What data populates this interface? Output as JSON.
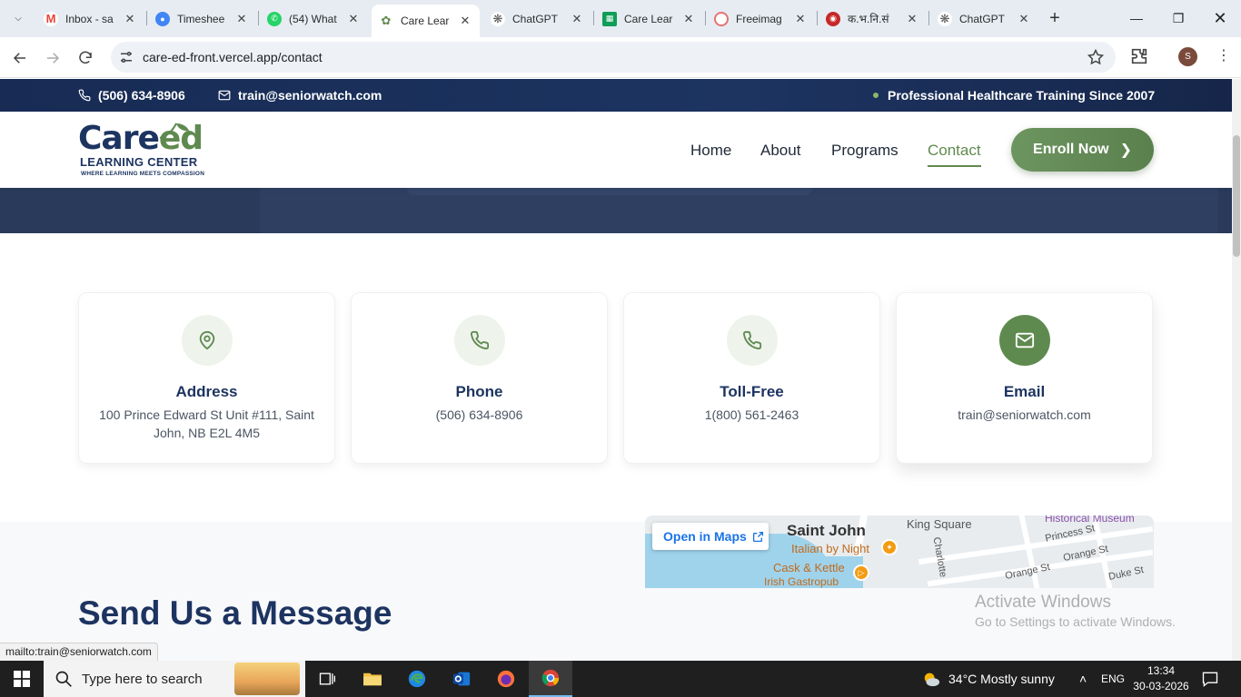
{
  "browser": {
    "tabs": [
      {
        "label": "Inbox - sa",
        "icon": "gmail-icon",
        "color": "#ea4335"
      },
      {
        "label": "Timeshee",
        "icon": "globe-icon",
        "color": "#4285f4"
      },
      {
        "label": "(54) What",
        "icon": "whatsapp-icon",
        "color": "#25d366"
      },
      {
        "label": "Care Lear",
        "icon": "care-leaf-icon",
        "color": "#5f8a4f",
        "active": true
      },
      {
        "label": "ChatGPT",
        "icon": "openai-icon",
        "color": "#555555"
      },
      {
        "label": "Care Lear",
        "icon": "sheets-icon",
        "color": "#0f9d58"
      },
      {
        "label": "Freeimag",
        "icon": "freeimages-icon",
        "color": "#e57373"
      },
      {
        "label": "क.भ.नि.सं",
        "icon": "seal-icon",
        "color": "#c62828"
      },
      {
        "label": "ChatGPT",
        "icon": "openai-icon",
        "color": "#555555"
      }
    ],
    "url": "care-ed-front.vercel.app/contact",
    "profile_initial": "S"
  },
  "topbar": {
    "phone": "(506) 634-8906",
    "email": "train@seniorwatch.com",
    "tagline": "Professional Healthcare Training Since 2007"
  },
  "header": {
    "logo_main_a": "Care",
    "logo_main_b": "ed",
    "logo_line": "LEARNING CENTER",
    "logo_tag": "WHERE LEARNING MEETS COMPASSION",
    "nav": [
      {
        "label": "Home"
      },
      {
        "label": "About"
      },
      {
        "label": "Programs"
      },
      {
        "label": "Contact",
        "active": true
      }
    ],
    "cta": "Enroll Now"
  },
  "contact_cards": [
    {
      "title": "Address",
      "value": "100 Prince Edward St Unit #111, Saint John, NB E2L 4M5",
      "icon": "map-pin-icon"
    },
    {
      "title": "Phone",
      "value": "(506) 634-8906",
      "icon": "phone-icon"
    },
    {
      "title": "Toll-Free",
      "value": "1(800) 561-2463",
      "icon": "phone-icon"
    },
    {
      "title": "Email",
      "value": "train@seniorwatch.com",
      "icon": "mail-icon"
    }
  ],
  "message_section": {
    "heading": "Send Us a Message"
  },
  "map": {
    "open_label": "Open in Maps",
    "labels": [
      "Saint John",
      "King Square",
      "Italian by Night",
      "Cask & Kettle",
      "Irish Gastropub",
      "Charlotte",
      "Princess St",
      "Orange St",
      "Duke St",
      "Historical Museum"
    ]
  },
  "status_url": "mailto:train@seniorwatch.com",
  "watermark": {
    "title": "Activate Windows",
    "subtitle": "Go to Settings to activate Windows."
  },
  "taskbar": {
    "search_placeholder": "Type here to search",
    "weather": "34°C  Mostly sunny",
    "lang": "ENG",
    "time": "13:34",
    "date": "30-03-2026"
  },
  "colors": {
    "navy": "#1d3461",
    "green": "#5f8a4f"
  }
}
